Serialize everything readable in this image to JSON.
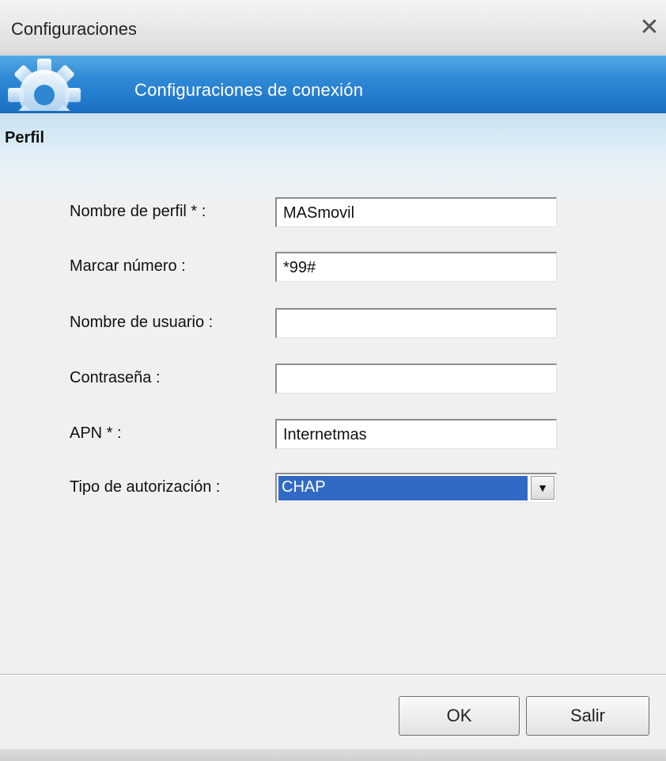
{
  "window": {
    "title": "Configuraciones",
    "close_icon": "close-icon"
  },
  "banner": {
    "title": "Configuraciones de conexión",
    "icon": "gear-icon"
  },
  "section": {
    "title": "Perfil"
  },
  "form": {
    "profile_name": {
      "label": "Nombre de perfil * :",
      "value": "MASmovil"
    },
    "dial_number": {
      "label": "Marcar número :",
      "value": "*99#"
    },
    "username": {
      "label": "Nombre de usuario :",
      "value": ""
    },
    "password": {
      "label": "Contraseña :",
      "value": ""
    },
    "apn": {
      "label": "APN * :",
      "value": "Internetmas"
    },
    "auth_type": {
      "label": "Tipo de autorización :",
      "selected": "CHAP"
    }
  },
  "buttons": {
    "ok": "OK",
    "exit": "Salir"
  },
  "colors": {
    "banner": "#2f8ad6",
    "selection": "#316ac5"
  }
}
